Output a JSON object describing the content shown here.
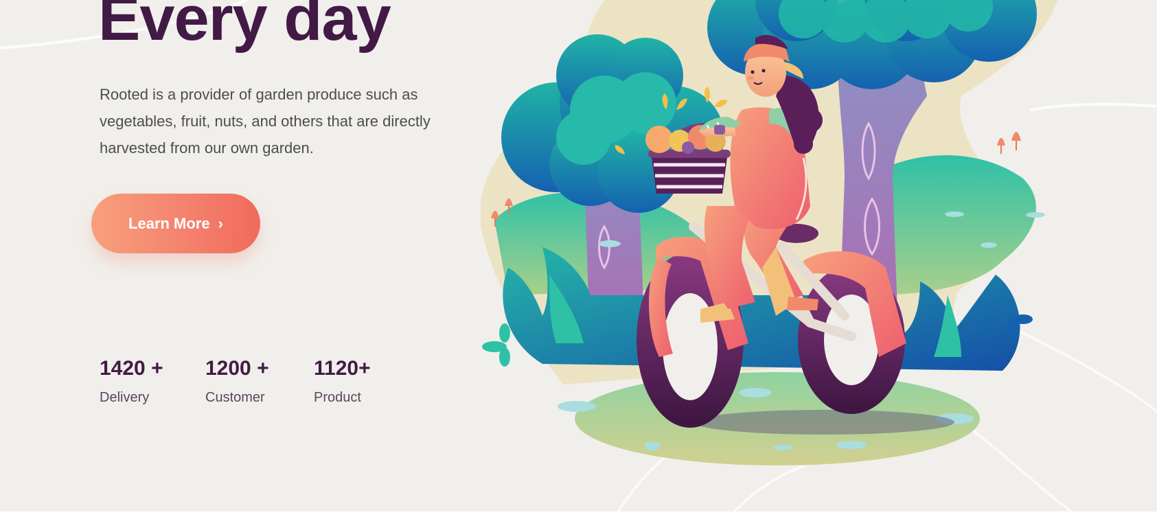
{
  "hero": {
    "title": "Every day",
    "description": "Rooted is a provider of garden produce such as vegetables, fruit, nuts, and others that are directly harvested from our own garden.",
    "cta_label": "Learn More",
    "cta_icon": "chevron-right-icon"
  },
  "stats": [
    {
      "value": "1420 +",
      "label": "Delivery"
    },
    {
      "value": "1200 +",
      "label": "Customer"
    },
    {
      "value": "1120+",
      "label": "Product"
    }
  ],
  "colors": {
    "background": "#f1efeb",
    "title": "#421a45",
    "accent": "#f4826e",
    "body_text": "#4d4d4d"
  }
}
